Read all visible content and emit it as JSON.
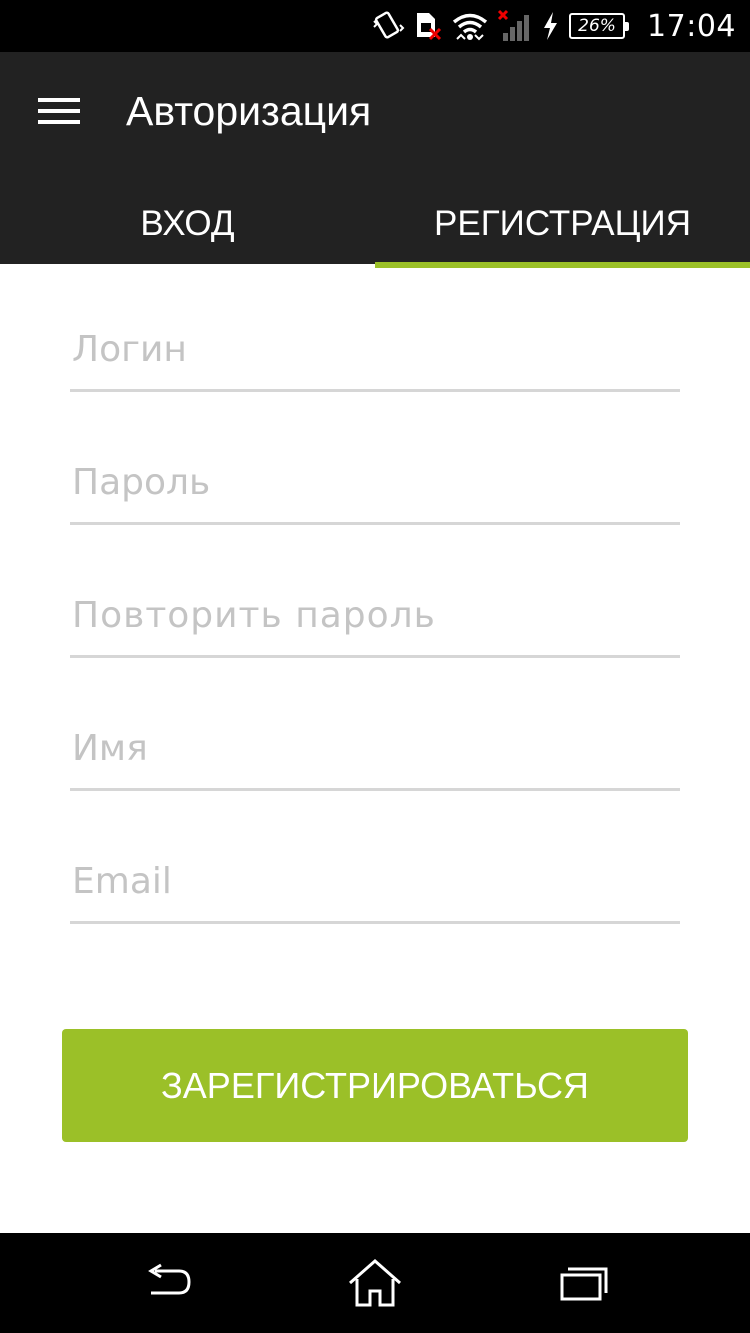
{
  "status_bar": {
    "battery_percent": "26%",
    "time": "17:04",
    "icons": [
      "vibrate-icon",
      "sim-error-icon",
      "wifi-icon",
      "signal-no-service-icon",
      "charging-icon",
      "battery-icon"
    ]
  },
  "app_bar": {
    "title": "Авторизация",
    "menu_icon": "hamburger-menu-icon"
  },
  "tabs": [
    {
      "label": "ВХОД",
      "active": false
    },
    {
      "label": "РЕГИСТРАЦИЯ",
      "active": true
    }
  ],
  "form": {
    "login_placeholder": "Логин",
    "login_value": "",
    "password_placeholder": "Пароль",
    "password_value": "",
    "repeat_password_placeholder": "Повторить пароль",
    "repeat_password_value": "",
    "name_placeholder": "Имя",
    "name_value": "",
    "email_placeholder": "Email",
    "email_value": ""
  },
  "register_button": {
    "label": "ЗАРЕГИСТРИРОВАТЬСЯ"
  },
  "nav_bar": {
    "icons": [
      "back-icon",
      "home-icon",
      "recent-apps-icon"
    ]
  },
  "colors": {
    "accent": "#9bc028",
    "app_bar": "#222222",
    "status_bar": "#000000"
  }
}
